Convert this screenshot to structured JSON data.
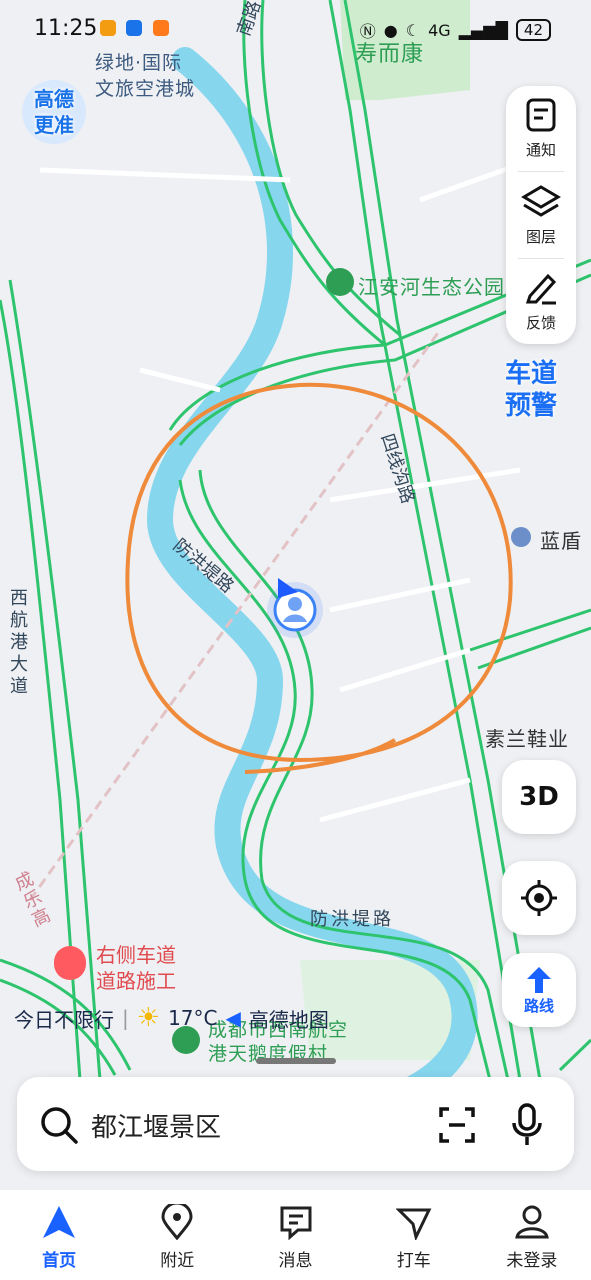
{
  "status_bar": {
    "time": "11:25",
    "signal": "4G",
    "battery": "42"
  },
  "map": {
    "labels": {
      "area_top": "绿地·国际\n文旅空港城",
      "poi_shouerkang": "寿而康",
      "poi_jiangan": "江安河生态公园",
      "road_sixian": "四线沟路",
      "road_fanghong": "防洪堤路",
      "road_fanghong_bottom": "防洪堤路",
      "road_xihang": "西航港大道",
      "road_north": "南路",
      "poi_landun": "蓝盾",
      "poi_sulan": "素兰鞋业",
      "poi_resort": "成都市西南航空\n港天鹅度假村",
      "road_chengle": "成乐高"
    },
    "badge_gaode": "高德\n更准",
    "badge_lane": "车道\n预警"
  },
  "side_panel": {
    "notice": "通知",
    "layers": "图层",
    "feedback": "反馈"
  },
  "btn_3d": "3D",
  "btn_route": "路线",
  "traffic_alert": {
    "line1": "右侧车道",
    "line2": "道路施工"
  },
  "weather": {
    "restriction": "今日不限行",
    "temp": "17°C",
    "brand": "高德地图"
  },
  "search": {
    "placeholder": "都江堰景区"
  },
  "nav": [
    {
      "label": "首页"
    },
    {
      "label": "附近"
    },
    {
      "label": "消息"
    },
    {
      "label": "打车"
    },
    {
      "label": "未登录"
    }
  ]
}
